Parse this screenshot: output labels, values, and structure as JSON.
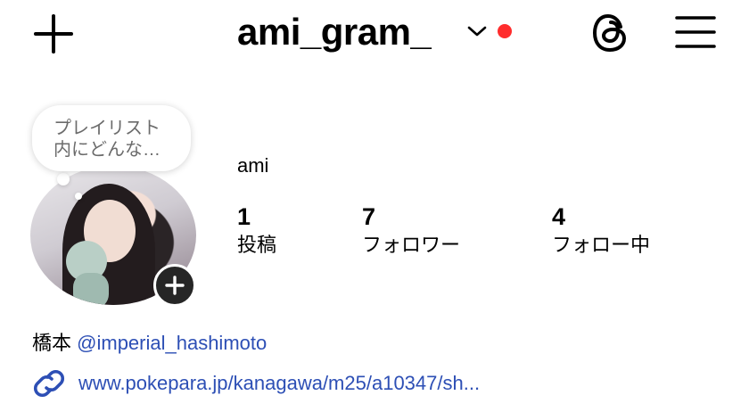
{
  "header": {
    "username": "ami_gram_",
    "create_icon": "plus-icon",
    "switch_account_icon": "chevron-down-icon",
    "notification_dot_color": "#ff2d2d",
    "threads_icon": "threads-icon",
    "menu_icon": "hamburger-menu-icon"
  },
  "profile": {
    "note_bubble": {
      "line1": "プレイリスト",
      "line2": "内にどんな…"
    },
    "display_name": "ami",
    "stats": [
      {
        "value": "1",
        "label": "投稿"
      },
      {
        "value": "7",
        "label": "フォロワー"
      },
      {
        "value": "4",
        "label": "フォロー中"
      }
    ],
    "add_story_icon": "plus-icon"
  },
  "bio": {
    "prefix": "橋本",
    "mention": "@imperial_hashimoto",
    "link_icon": "link-icon",
    "link_text": "www.pokepara.jp/kanagawa/m25/a10347/sh..."
  },
  "colors": {
    "link": "#2d4fb5",
    "dark_button": "#262626"
  }
}
